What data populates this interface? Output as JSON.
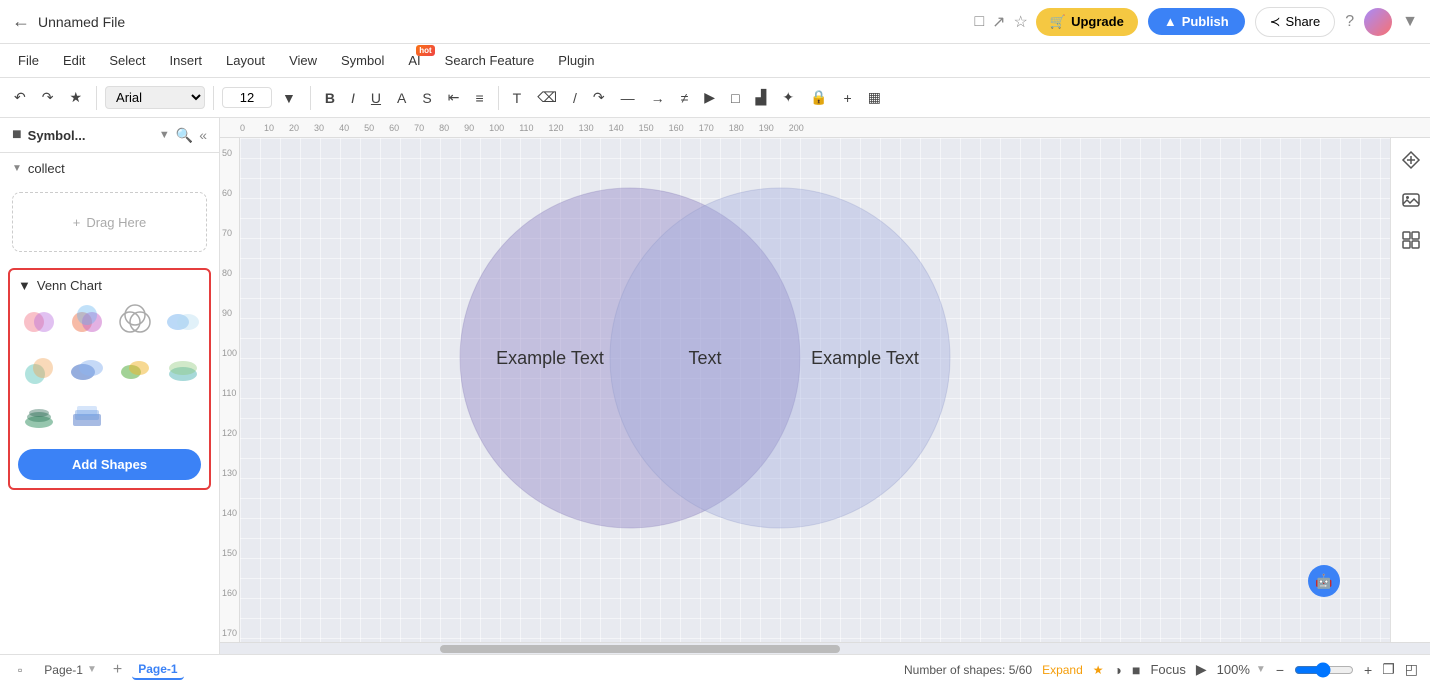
{
  "titlebar": {
    "title": "Unnamed File",
    "upgrade_label": "Upgrade",
    "publish_label": "Publish",
    "share_label": "Share"
  },
  "menubar": {
    "items": [
      "File",
      "Edit",
      "Select",
      "Insert",
      "Layout",
      "View",
      "Symbol",
      "AI",
      "Search Feature",
      "Plugin"
    ],
    "ai_hot": "hot"
  },
  "toolbar": {
    "font_family": "Arial",
    "font_size": "12",
    "bold": "B",
    "italic": "I",
    "underline": "U"
  },
  "sidebar": {
    "title": "Symbol...",
    "section_collect": "collect",
    "drag_here": "Drag Here",
    "venn_chart_title": "Venn Chart",
    "add_shapes_label": "Add Shapes"
  },
  "canvas": {
    "venn": {
      "left_text": "Example Text",
      "center_text": "Text",
      "right_text": "Example Text"
    }
  },
  "statusbar": {
    "page_label": "Page-1",
    "active_page": "Page-1",
    "shapes_info": "Number of shapes: 5/60",
    "expand_label": "Expand",
    "zoom_value": "100%",
    "focus_label": "Focus"
  }
}
